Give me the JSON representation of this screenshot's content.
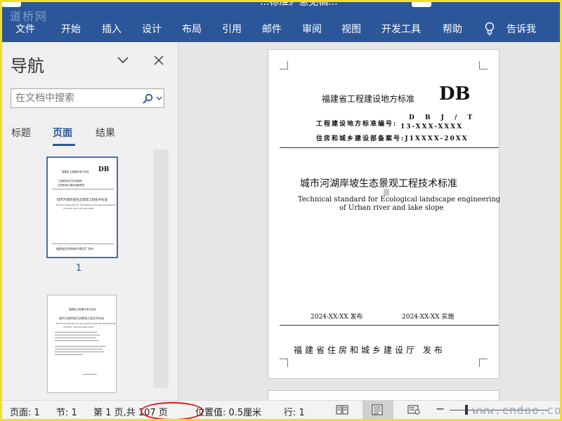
{
  "watermark_top": "道桥网",
  "titlebar": {
    "partial_title": "...标准》意见稿..."
  },
  "menu": [
    "文件",
    "开始",
    "插入",
    "设计",
    "布局",
    "引用",
    "邮件",
    "审阅",
    "视图",
    "开发工具",
    "帮助",
    "告诉我"
  ],
  "menu_icons": {
    "tell_me": "lightbulb-icon"
  },
  "nav": {
    "title": "导航",
    "search_placeholder": "在文档中搜索",
    "tabs": [
      "标题",
      "页面",
      "结果"
    ],
    "active_tab": "页面",
    "thumb1": {
      "page_number": "1",
      "header": "福建省工程建设地方标准",
      "db": "DB",
      "code_line1": "工程建设地方标准编号",
      "code_line2": "住房和城乡建设部备案号",
      "title": "城市河湖岸坡生态景观工程技术标准",
      "en1": "Technical standard for Ecological landscape engineering",
      "en2": "of Urban river and lake slope",
      "issuer": "福建省住房和城乡建设厅  发布"
    },
    "thumb2": {
      "line1": "福建省工程建设地方标准",
      "line2": "城市河湖岸坡生态景观工程技术标准",
      "line3": "Technical standard for Ecological landscape engineering",
      "line4": "of Urban river and lake slope"
    }
  },
  "page": {
    "header": "福建省工程建设地方标准",
    "db": "DB",
    "code_label": "工程建设地方标准编号:",
    "code_value_1": "D B J / T",
    "code_value_2": "13-XXX-XXXX",
    "record_label": "住房和城乡建设部备案号:",
    "record_value": "J1XXXX-20XX",
    "title_zh": "城市河湖岸坡生态景观工程技术标准",
    "title_en_1": "Technical standard for Ecological landscape engineering",
    "title_en_2": "of Urban river and lake slope",
    "issue_date": "2024-XX-XX  发布",
    "impl_date": "2024-XX-XX  实施",
    "issuer": "福建省住房和城乡建设厅     发布"
  },
  "status": {
    "page": "页面: 1",
    "section": "节: 1",
    "page_of": "第 1 页,共 107 页",
    "position": "位置值: 0.5厘米",
    "line": "行: 1",
    "zoom_minus": "−",
    "highlight_color": "#e01818"
  },
  "watermark_bottom": "www.cndao.com",
  "colors": {
    "ribbon": "#2b579a",
    "frame": "#f2de2a"
  }
}
